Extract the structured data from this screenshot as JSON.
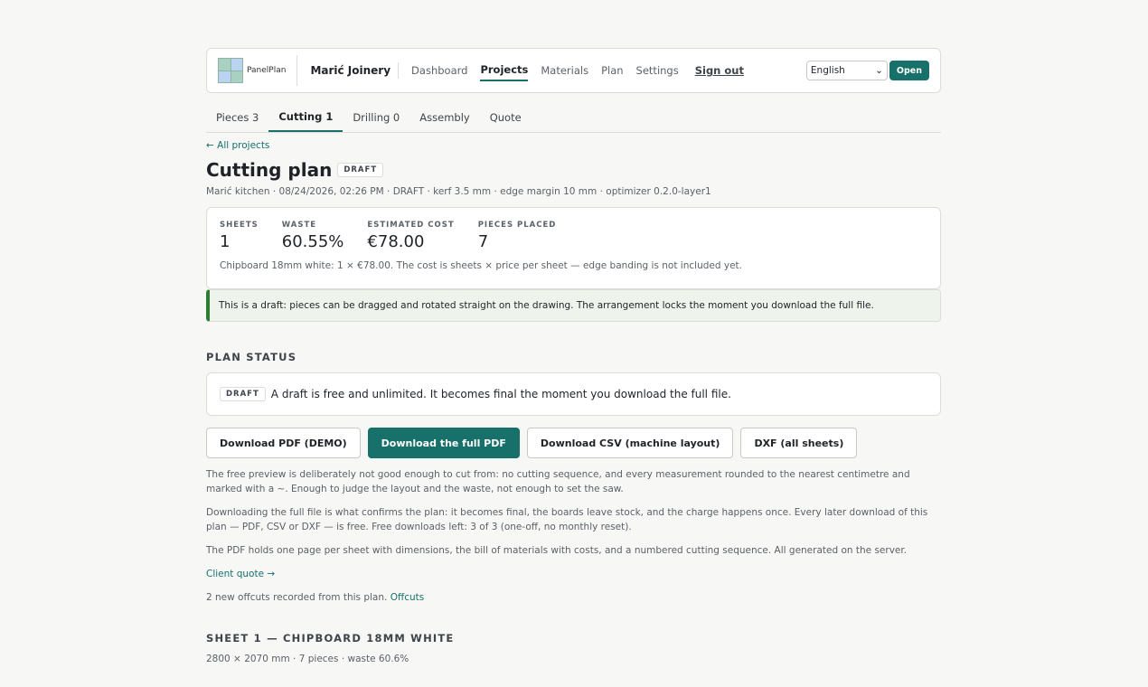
{
  "header": {
    "logo_text": "PanelPlan",
    "workshop": "Marić Joinery",
    "nav": [
      "Dashboard",
      "Projects",
      "Materials",
      "Plan",
      "Settings"
    ],
    "signout": "Sign out",
    "language": "English",
    "open": "Open"
  },
  "tabs": [
    {
      "label": "Pieces 3"
    },
    {
      "label": "Cutting 1"
    },
    {
      "label": "Drilling 0"
    },
    {
      "label": "Assembly"
    },
    {
      "label": "Quote"
    }
  ],
  "back_link": "← All projects",
  "page": {
    "title": "Cutting plan",
    "badge": "DRAFT",
    "meta": "Marić kitchen · 08/24/2026, 02:26 PM · DRAFT · kerf 3.5 mm · edge margin 10 mm · optimizer 0.2.0-layer1"
  },
  "stats": {
    "items": [
      {
        "label": "SHEETS",
        "value": "1"
      },
      {
        "label": "WASTE",
        "value": "60.55%"
      },
      {
        "label": "ESTIMATED COST",
        "value": "€78.00"
      },
      {
        "label": "PIECES PLACED",
        "value": "7"
      }
    ],
    "note": "Chipboard 18mm white: 1 × €78.00. The cost is sheets × price per sheet — edge banding is not included yet."
  },
  "notice": "This is a draft: pieces can be dragged and rotated straight on the drawing. The arrangement locks the moment you download the full file.",
  "plan_status": {
    "heading": "PLAN STATUS",
    "badge": "DRAFT",
    "text": "A draft is free and unlimited. It becomes final the moment you download the full file."
  },
  "buttons": {
    "pdf_demo": "Download PDF (DEMO)",
    "pdf_full": "Download the full PDF",
    "csv": "Download CSV (machine layout)",
    "dxf": "DXF (all sheets)"
  },
  "paragraphs": {
    "p1": "The free preview is deliberately not good enough to cut from: no cutting sequence, and every measurement rounded to the nearest centimetre and marked with a ~. Enough to judge the layout and the waste, not enough to set the saw.",
    "p2": "Downloading the full file is what confirms the plan: it becomes final, the boards leave stock, and the charge happens once. Every later download of this plan — PDF, CSV or DXF — is free. Free downloads left: 3 of 3 (one-off, no monthly reset).",
    "p3": "The PDF holds one page per sheet with dimensions, the bill of materials with costs, and a numbered cutting sequence. All generated on the server.",
    "client_quote": "Client quote →",
    "offcuts_text": "2 new offcuts recorded from this plan.",
    "offcuts_link": "Offcuts"
  },
  "sheet": {
    "heading": "SHEET 1 — CHIPBOARD 18MM WHITE",
    "meta": "2800 × 2070 mm · 7 pieces · waste 60.6%"
  }
}
